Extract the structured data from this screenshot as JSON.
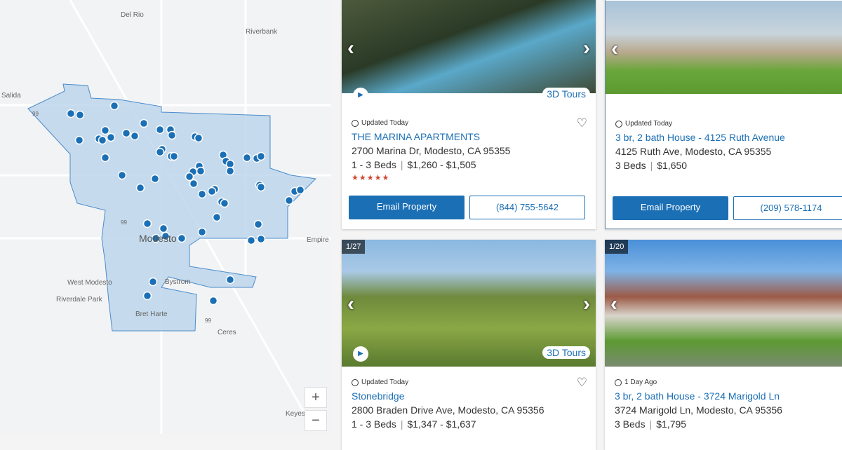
{
  "map": {
    "labels": [
      "Del Rio",
      "Riverbank",
      "Salida",
      "Modesto",
      "Empire",
      "West Modesto",
      "Bystrom",
      "Riverdale Park",
      "Bret Harte",
      "Ceres",
      "Keyes"
    ],
    "highway_labels": [
      "99",
      "99",
      "99"
    ],
    "zoom_in": "+",
    "zoom_out": "−",
    "area_color": "#b9d3ea",
    "marker_color": "#1b6fb5"
  },
  "listings": [
    {
      "updated": "Updated Today",
      "title": "THE MARINA APARTMENTS",
      "address": "2700 Marina Dr, Modesto, CA 95355",
      "beds": "1 - 3 Beds",
      "price": "$1,260 - $1,505",
      "stars": "★★★★★",
      "rating": 5,
      "tours": "3D Tours",
      "email": "Email Property",
      "phone": "(844) 755-5642"
    },
    {
      "updated": "Updated Today",
      "title": "3 br, 2 bath House - 4125 Ruth Avenue",
      "address": "4125 Ruth Ave, Modesto, CA 95355",
      "beds": "3 Beds",
      "price": "$1,650",
      "email": "Email Property",
      "phone": "(209) 578-1174"
    },
    {
      "counter": "1/27",
      "updated": "Updated Today",
      "title": "Stonebridge",
      "address": "2800 Braden Drive Ave, Modesto, CA 95356",
      "beds": "1 - 3 Beds",
      "price": "$1,347 - $1,637",
      "tours": "3D Tours"
    },
    {
      "counter": "1/20",
      "updated": "1 Day Ago",
      "title": "3 br, 2 bath House - 3724 Marigold Ln",
      "address": "3724 Marigold Ln, Modesto, CA 95356",
      "beds": "3 Beds",
      "price": "$1,795"
    }
  ]
}
